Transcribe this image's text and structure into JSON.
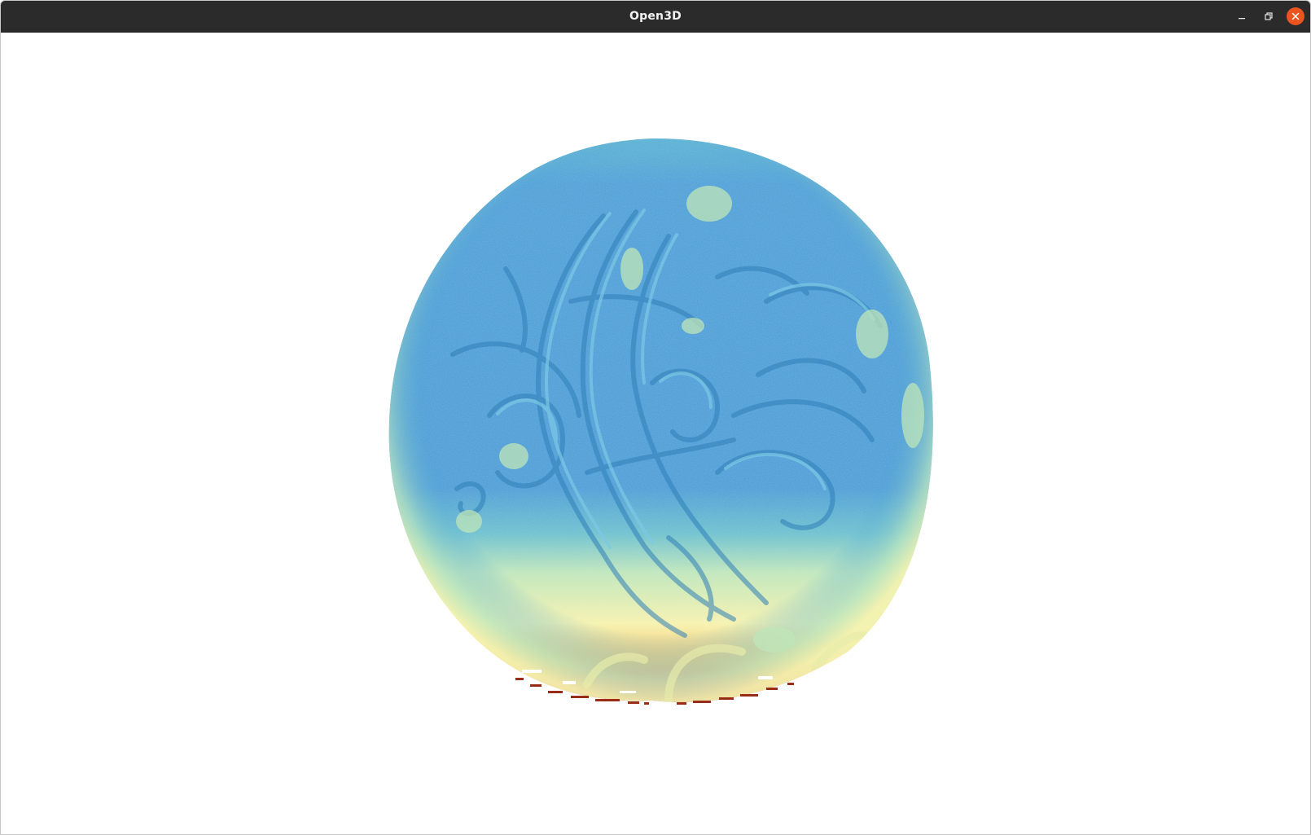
{
  "window": {
    "title": "Open3D",
    "controls": {
      "minimize_icon": "minimize-icon",
      "maximize_icon": "restore-icon",
      "close_icon": "close-icon"
    }
  },
  "viewport": {
    "background": "#ffffff",
    "content": "point-cloud",
    "colormap": [
      "#3f9fd8",
      "#59b8d6",
      "#a9e0c0",
      "#f4f3b0",
      "#f5c563",
      "#ea6a2c",
      "#a02a12"
    ]
  }
}
